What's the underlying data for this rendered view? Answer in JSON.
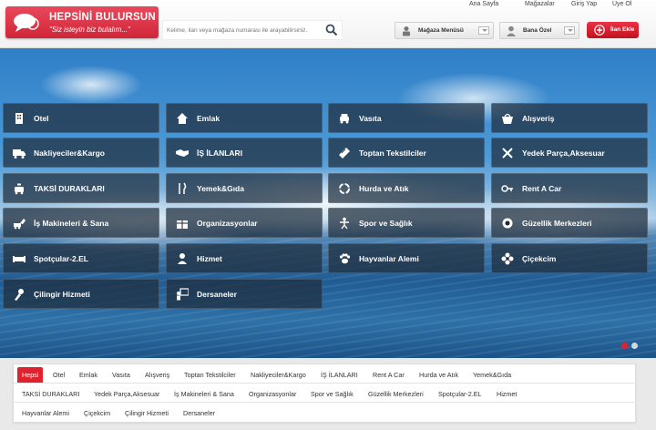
{
  "header": {
    "logo": {
      "title": "HEPSİNİ BULURSUN",
      "tagline": "\"Siz isteyin biz bulalım...\""
    },
    "search": {
      "placeholder": "Kelime, ilan veya mağaza numarası ile arayabilirsiniz."
    },
    "top_links": [
      "Ana Sayfa",
      "Mağazalar",
      "Giriş Yap",
      "Üye Ol"
    ],
    "store_menu": "Mağaza Menüsü",
    "user_menu": "Bana Özel",
    "add_listing": "İlan Ekle"
  },
  "colors": {
    "brand_red": "#d1263a",
    "tile_bg": "#1e2d3c",
    "active_dot": "#e0222f",
    "inactive_dot": "#cfd8e0"
  },
  "categories": [
    {
      "label": "Otel",
      "icon": "building-icon"
    },
    {
      "label": "Emlak",
      "icon": "house-icon"
    },
    {
      "label": "Vasıta",
      "icon": "car-icon"
    },
    {
      "label": "Alışveriş",
      "icon": "basket-icon"
    },
    {
      "label": "Nakliyeciler&Kargo",
      "icon": "truck-icon"
    },
    {
      "label": "İŞ İLANLARI",
      "icon": "handshake-icon"
    },
    {
      "label": "Toptan Tekstilciler",
      "icon": "fabric-icon"
    },
    {
      "label": "Yedek Parça,Aksesuar",
      "icon": "tools-icon"
    },
    {
      "label": "TAKSİ DURAKLARI",
      "icon": "taxi-icon"
    },
    {
      "label": "Yemek&Gıda",
      "icon": "cutlery-icon"
    },
    {
      "label": "Hurda ve Atık",
      "icon": "recycle-icon"
    },
    {
      "label": "Rent A Car",
      "icon": "key-car-icon"
    },
    {
      "label": "İş Makineleri & Sana",
      "icon": "excavator-icon"
    },
    {
      "label": "Organizasyonlar",
      "icon": "gift-icon"
    },
    {
      "label": "Spor ve Sağlık",
      "icon": "fitness-icon"
    },
    {
      "label": "Güzellik Merkezleri",
      "icon": "beauty-icon"
    },
    {
      "label": "Spotçular-2.EL",
      "icon": "sofa-icon"
    },
    {
      "label": "Hizmet",
      "icon": "worker-icon"
    },
    {
      "label": "Hayvanlar Alemi",
      "icon": "paw-icon"
    },
    {
      "label": "Çiçekcim",
      "icon": "flower-icon"
    },
    {
      "label": "Çilingir Hizmeti",
      "icon": "locksmith-icon"
    },
    {
      "label": "Dersaneler",
      "icon": "teacher-icon"
    }
  ],
  "slider": {
    "active_slide": 1,
    "total_slides": 2
  },
  "tabs": {
    "active": "Hepsi",
    "rows": [
      [
        "Hepsi",
        "Otel",
        "Emlak",
        "Vasıta",
        "Alışveriş",
        "Toptan Tekstilciler",
        "Nakliyeciler&Kargo",
        "İŞ İLANLARI",
        "Rent A Car",
        "Hurda ve Atık",
        "Yemek&Gıda"
      ],
      [
        "TAKSİ DURAKLARI",
        "Yedek Parça,Aksesuar",
        "İş Makineleri & Sana",
        "Organizasyonlar",
        "Spor ve Sağlık",
        "Güzellik Merkezleri",
        "Spotçular-2.EL",
        "Hizmet"
      ],
      [
        "Hayvanlar Alemi",
        "Çiçekcim",
        "Çilingir Hizmeti",
        "Dersaneler"
      ]
    ]
  }
}
